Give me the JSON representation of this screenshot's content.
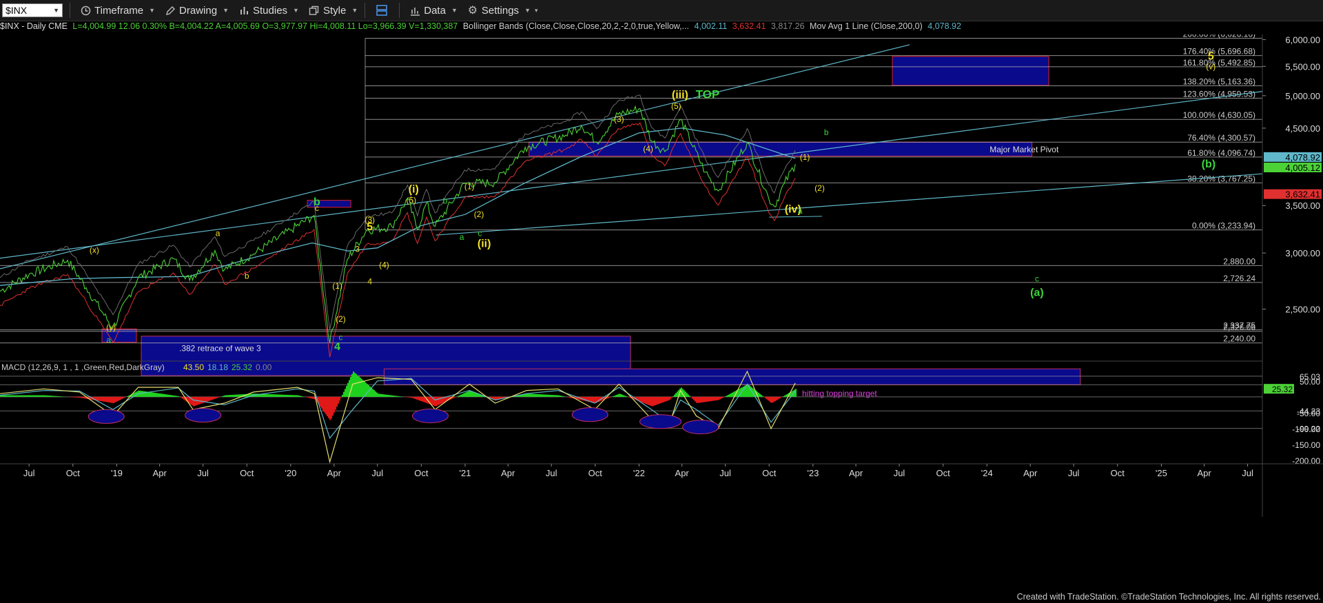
{
  "toolbar": {
    "symbol": "$INX",
    "timeframe_label": "Timeframe",
    "drawing_label": "Drawing",
    "studies_label": "Studies",
    "style_label": "Style",
    "data_label": "Data",
    "settings_label": "Settings"
  },
  "info": {
    "symbol_line": "$INX - Daily CME",
    "ohlc": "L=4,004.99 12.06 0.30% B=4,004.22 A=4,005.69 O=3,977.97 Hi=4,008.11 Lo=3,966.39 V=1,330,387",
    "boll_label": "Bollinger Bands (Close,Close,Close,20,2,-2,0,true,Yellow,...",
    "boll_upper": "4,002.11",
    "boll_lower": "3,632.41",
    "boll_mid": "3,817.26",
    "ma_label": "Mov Avg 1 Line (Close,200,0)",
    "ma_value": "4,078.92"
  },
  "colors": {
    "price": "#4cd137",
    "ma200": "#5fb7c9",
    "boll_band": "#e03030",
    "fib_line": "#bbbbbb",
    "pivot_box": "#0a0a8c",
    "wave_yellow": "#f0e02a",
    "wave_green": "#39d639",
    "target_box_border": "#e02020",
    "macd_green": "#1fd11f",
    "macd_red": "#e01818",
    "magenta_text": "#e040e0"
  },
  "chart_data": {
    "type": "line",
    "title": "$INX - Daily",
    "y_scale": "log",
    "ylim": [
      2150,
      6100
    ],
    "price_ticks": [
      "6,000.00",
      "5,500.00",
      "5,000.00",
      "4,500.00",
      "3,500.00",
      "3,000.00",
      "2,500.00"
    ],
    "price_tick_values": [
      6000,
      5500,
      5000,
      4500,
      3500,
      3000,
      2500
    ],
    "x_tick_labels": [
      "Jul",
      "Oct",
      "'19",
      "Apr",
      "Jul",
      "Oct",
      "'20",
      "Apr",
      "Jul",
      "Oct",
      "'21",
      "Apr",
      "Jul",
      "Oct",
      "'22",
      "Apr",
      "Jul",
      "Oct",
      "'23",
      "Apr",
      "Jul",
      "Oct",
      "'24",
      "Apr",
      "Jul",
      "Oct",
      "'25",
      "Apr",
      "Jul"
    ],
    "x_tick_dates": [
      "2018-07-01",
      "2018-10-01",
      "2019-01-01",
      "2019-04-01",
      "2019-07-01",
      "2019-10-01",
      "2020-01-01",
      "2020-04-01",
      "2020-07-01",
      "2020-10-01",
      "2021-01-01",
      "2021-04-01",
      "2021-07-01",
      "2021-10-01",
      "2022-01-01",
      "2022-04-01",
      "2022-07-01",
      "2022-10-01",
      "2023-01-01",
      "2023-04-01",
      "2023-07-01",
      "2023-10-01",
      "2024-01-01",
      "2024-04-01",
      "2024-07-01",
      "2024-10-01",
      "2025-01-01",
      "2025-04-01",
      "2025-07-01"
    ],
    "series": [
      {
        "name": "$INX",
        "x": [
          "2018-05-01",
          "2018-07-01",
          "2018-09-20",
          "2018-10-29",
          "2018-12-24",
          "2019-02-15",
          "2019-04-30",
          "2019-06-03",
          "2019-07-26",
          "2019-08-15",
          "2019-10-15",
          "2019-12-31",
          "2020-02-19",
          "2020-03-23",
          "2020-04-29",
          "2020-06-08",
          "2020-07-31",
          "2020-09-02",
          "2020-09-23",
          "2020-10-12",
          "2020-10-30",
          "2020-12-31",
          "2021-03-04",
          "2021-05-07",
          "2021-07-31",
          "2021-09-02",
          "2021-10-04",
          "2021-11-18",
          "2022-01-03",
          "2022-01-27",
          "2022-02-24",
          "2022-03-29",
          "2022-05-20",
          "2022-06-16",
          "2022-08-16",
          "2022-09-30",
          "2022-10-12",
          "2022-11-02",
          "2022-11-25"
        ],
        "y": [
          2650,
          2800,
          2930,
          2680,
          2350,
          2770,
          2945,
          2745,
          3025,
          2840,
          2990,
          3230,
          3390,
          2240,
          2940,
          3230,
          3270,
          3580,
          3240,
          3530,
          3270,
          3760,
          3770,
          4230,
          4400,
          4540,
          4300,
          4705,
          4795,
          4320,
          4170,
          4630,
          3900,
          3670,
          4300,
          3585,
          3490,
          3760,
          4005
        ]
      },
      {
        "name": "Mov Avg 1 Line (Close,200,0)",
        "x": [
          "2018-05-01",
          "2018-10-01",
          "2019-01-01",
          "2019-06-01",
          "2019-10-01",
          "2020-02-15",
          "2020-05-01",
          "2020-07-01",
          "2020-10-01",
          "2021-01-01",
          "2021-05-01",
          "2021-09-01",
          "2022-01-01",
          "2022-04-01",
          "2022-07-01",
          "2022-11-25"
        ],
        "y": [
          2700,
          2760,
          2770,
          2780,
          2940,
          3100,
          3020,
          3050,
          3280,
          3400,
          3750,
          4100,
          4430,
          4500,
          4400,
          4079
        ]
      }
    ],
    "fib_levels": [
      {
        "label": "200.00% (6,026.16)",
        "value": 6026.16
      },
      {
        "label": "176.40% (5,696.68)",
        "value": 5696.68
      },
      {
        "label": "161.80% (5,492.85)",
        "value": 5492.85
      },
      {
        "label": "138.20% (5,163.36)",
        "value": 5163.36
      },
      {
        "label": "123.60% (4,959.53)",
        "value": 4959.53
      },
      {
        "label": "100.00% (4,630.05)",
        "value": 4630.05
      },
      {
        "label": "76.40% (4,300.57)",
        "value": 4300.57
      },
      {
        "label": "61.80% (4,096.74)",
        "value": 4096.74
      },
      {
        "label": "38.20% (3,767.25)",
        "value": 3767.25
      },
      {
        "label": "0.00% (3,233.94)",
        "value": 3233.94
      }
    ],
    "support_levels": [
      {
        "label": "2,880.00",
        "value": 2880
      },
      {
        "label": "2,726.24",
        "value": 2726.24
      },
      {
        "label": "2,337.75",
        "value": 2337.75
      },
      {
        "label": "2,326.06",
        "value": 2326.06
      },
      {
        "label": "2,240.00",
        "value": 2240
      }
    ],
    "last_price_tags": [
      {
        "label": "4,078.92",
        "value": 4078.92,
        "color": "#5fb7c9"
      },
      {
        "label": "4,005.12",
        "value": 4005.12,
        "color": "#4cd137"
      },
      {
        "label": "3,632.41",
        "value": 3632.41,
        "color": "#e03030"
      }
    ],
    "annotations": {
      "pivot_label": "Major Market Pivot",
      "retrace_label": ".382 retrace of wave 3",
      "top_label": "TOP",
      "topping_label": "hitting topping target"
    },
    "wave_labels": [
      {
        "t": "(x)",
        "c": "y",
        "x": "2018-11-15",
        "v": 3000
      },
      {
        "t": "(y)",
        "c": "y",
        "x": "2018-12-20",
        "v": 2335
      },
      {
        "t": "a",
        "c": "g",
        "x": "2018-12-15",
        "v": 2240
      },
      {
        "t": "a",
        "c": "y",
        "x": "2019-08-01",
        "v": 3170
      },
      {
        "t": "b",
        "c": "y",
        "x": "2019-10-01",
        "v": 2760
      },
      {
        "t": "b",
        "c": "g",
        "x": "2020-02-25",
        "v": 3500
      },
      {
        "t": "c",
        "c": "y",
        "x": "2020-02-25",
        "v": 3440
      },
      {
        "t": "3",
        "c": "y",
        "x": "2020-05-20",
        "v": 3010
      },
      {
        "t": "(1)",
        "c": "y",
        "x": "2020-04-08",
        "v": 2670
      },
      {
        "t": "(2)",
        "c": "y",
        "x": "2020-04-15",
        "v": 2400
      },
      {
        "t": "c",
        "c": "g",
        "x": "2020-04-15",
        "v": 2260
      },
      {
        "t": "4",
        "c": "g",
        "x": "2020-04-08",
        "v": 2190
      },
      {
        "t": "4",
        "c": "y",
        "x": "2020-06-15",
        "v": 2710
      },
      {
        "t": "(3)",
        "c": "y",
        "x": "2020-06-15",
        "v": 3310
      },
      {
        "t": "5",
        "c": "y",
        "x": "2020-06-15",
        "v": 3230
      },
      {
        "t": "(4)",
        "c": "y",
        "x": "2020-07-15",
        "v": 2860
      },
      {
        "t": "(5)",
        "c": "y",
        "x": "2020-09-10",
        "v": 3530
      },
      {
        "t": "(i)",
        "c": "y",
        "x": "2020-09-15",
        "v": 3650
      },
      {
        "t": "b",
        "c": "g",
        "x": "2020-11-20",
        "v": 3520
      },
      {
        "t": "(1)",
        "c": "y",
        "x": "2021-01-10",
        "v": 3690
      },
      {
        "t": "(2)",
        "c": "y",
        "x": "2021-01-30",
        "v": 3370
      },
      {
        "t": "a",
        "c": "g",
        "x": "2020-12-25",
        "v": 3130
      },
      {
        "t": "c",
        "c": "g",
        "x": "2021-02-01",
        "v": 3170
      },
      {
        "t": "(ii)",
        "c": "y",
        "x": "2021-02-10",
        "v": 3060
      },
      {
        "t": "(3)",
        "c": "y",
        "x": "2021-11-20",
        "v": 4590
      },
      {
        "t": "(4)",
        "c": "y",
        "x": "2022-01-20",
        "v": 4170
      },
      {
        "t": "(5)",
        "c": "y",
        "x": "2022-03-20",
        "v": 4790
      },
      {
        "t": "(iii)",
        "c": "y",
        "x": "2022-03-28",
        "v": 4960
      },
      {
        "t": "(1)",
        "c": "y",
        "x": "2022-12-15",
        "v": 4060
      },
      {
        "t": "(2)",
        "c": "y",
        "x": "2023-01-15",
        "v": 3670
      },
      {
        "t": "(iv)",
        "c": "y",
        "x": "2022-11-20",
        "v": 3420
      },
      {
        "t": "a",
        "c": "g",
        "x": "2022-12-05",
        "v": 3410
      },
      {
        "t": "b",
        "c": "g",
        "x": "2023-01-29",
        "v": 4400
      },
      {
        "t": "(b)",
        "c": "g",
        "x": "2025-04-10",
        "v": 3960
      },
      {
        "t": "c",
        "c": "g",
        "x": "2024-04-15",
        "v": 2735
      },
      {
        "t": "(a)",
        "c": "g",
        "x": "2024-04-15",
        "v": 2610
      },
      {
        "t": "5",
        "c": "y",
        "x": "2025-04-15",
        "v": 5620
      },
      {
        "t": "(v)",
        "c": "y",
        "x": "2025-04-15",
        "v": 5450
      }
    ],
    "macd": {
      "label": "MACD (12,26,9, 1 , 1 ,Green,Red,DarkGray)",
      "values_text": [
        "43.50",
        "18.18",
        "25.32",
        "0.00"
      ],
      "ticks": [
        "65.03",
        "50.00",
        "-44.23",
        "-50.00",
        "-99.22",
        "-100.00",
        "-150.00",
        "-200.00"
      ],
      "tick_values": [
        65.03,
        50,
        -44.23,
        -50,
        -99.22,
        -100,
        -150,
        -200
      ],
      "last_value": "25.32",
      "ylim": [
        -215,
        95
      ],
      "x": [
        "2018-05-01",
        "2018-08-01",
        "2018-10-15",
        "2018-12-24",
        "2019-02-15",
        "2019-05-10",
        "2019-06-10",
        "2019-08-15",
        "2019-10-15",
        "2020-01-15",
        "2020-02-20",
        "2020-03-23",
        "2020-05-10",
        "2020-07-01",
        "2020-09-10",
        "2020-10-30",
        "2021-01-10",
        "2021-03-05",
        "2021-05-10",
        "2021-07-15",
        "2021-09-30",
        "2021-11-20",
        "2022-01-27",
        "2022-03-05",
        "2022-03-29",
        "2022-05-01",
        "2022-06-16",
        "2022-08-16",
        "2022-10-05",
        "2022-11-25"
      ],
      "macd_line": [
        10,
        25,
        15,
        -60,
        30,
        30,
        -40,
        -20,
        15,
        30,
        10,
        -205,
        40,
        60,
        55,
        -40,
        40,
        -20,
        20,
        25,
        -40,
        40,
        -70,
        -90,
        20,
        -60,
        -100,
        80,
        -100,
        43.5
      ],
      "signal_line": [
        5,
        20,
        18,
        -40,
        10,
        28,
        -10,
        -25,
        5,
        25,
        18,
        -130,
        -40,
        50,
        58,
        -10,
        20,
        -10,
        10,
        20,
        -20,
        30,
        -40,
        -80,
        -10,
        -40,
        -90,
        40,
        -80,
        18.18
      ]
    }
  },
  "footer": "Created with TradeStation. ©TradeStation Technologies, Inc. All rights reserved."
}
